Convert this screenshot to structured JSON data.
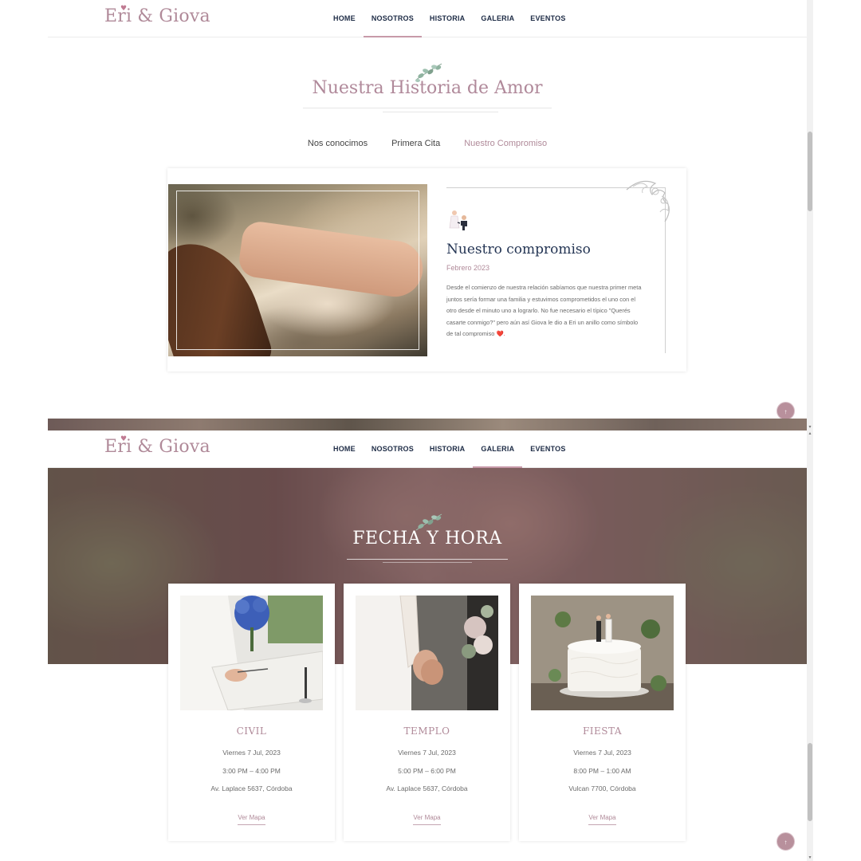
{
  "brand": {
    "name": "Eri & Giova"
  },
  "nav": {
    "items": [
      {
        "label": "HOME"
      },
      {
        "label": "NOSOTROS"
      },
      {
        "label": "HISTORIA"
      },
      {
        "label": "GALERIA"
      },
      {
        "label": "EVENTOS"
      }
    ],
    "active_top": "NOSOTROS",
    "active_bottom": "GALERIA"
  },
  "story": {
    "title": "Nuestra Historia de Amor",
    "tabs": [
      {
        "label": "Nos conocimos"
      },
      {
        "label": "Primera Cita"
      },
      {
        "label": "Nuestro Compromiso"
      }
    ],
    "active_tab": "Nuestro Compromiso",
    "card": {
      "heading": "Nuestro compromiso",
      "date": "Febrero 2023",
      "body": "Desde el comienzo de nuestra relación sabíamos que nuestra primer meta juntos sería formar una familia y estuvimos comprometidos el uno con el otro desde el minuto uno a lograrlo. No fue necesario el típico \"Querés casarte conmigo?\" pero aún así Giova le dio a Eri un anillo como símbolo de tal compromiso",
      "body_emoji": "❤️."
    }
  },
  "events": {
    "title": "FECHA Y HORA",
    "cards": [
      {
        "name": "CIVIL",
        "date": "Viernes 7 Jul, 2023",
        "time": "3:00 PM – 4:00 PM",
        "address": "Av. Laplace 5637, Córdoba",
        "map_label": "Ver Mapa"
      },
      {
        "name": "TEMPLO",
        "date": "Viernes 7 Jul, 2023",
        "time": "5:00 PM – 6:00 PM",
        "address": "Av. Laplace 5637, Córdoba",
        "map_label": "Ver Mapa"
      },
      {
        "name": "FIESTA",
        "date": "Viernes 7 Jul, 2023",
        "time": "8:00 PM – 1:00 AM",
        "address": "Vulcan 7700, Córdoba",
        "map_label": "Ver Mapa"
      }
    ]
  },
  "icons": {
    "back_to_top": "arrow-up-icon",
    "leaf": "eucalyptus-leaf-icon",
    "ornament": "floral-corner-ornament",
    "couple": "couple-proposal-icon"
  },
  "colors": {
    "accent": "#b08a99",
    "nav_text": "#1d2b45",
    "heading": "#243554",
    "active_underline": "#c79aa9"
  }
}
